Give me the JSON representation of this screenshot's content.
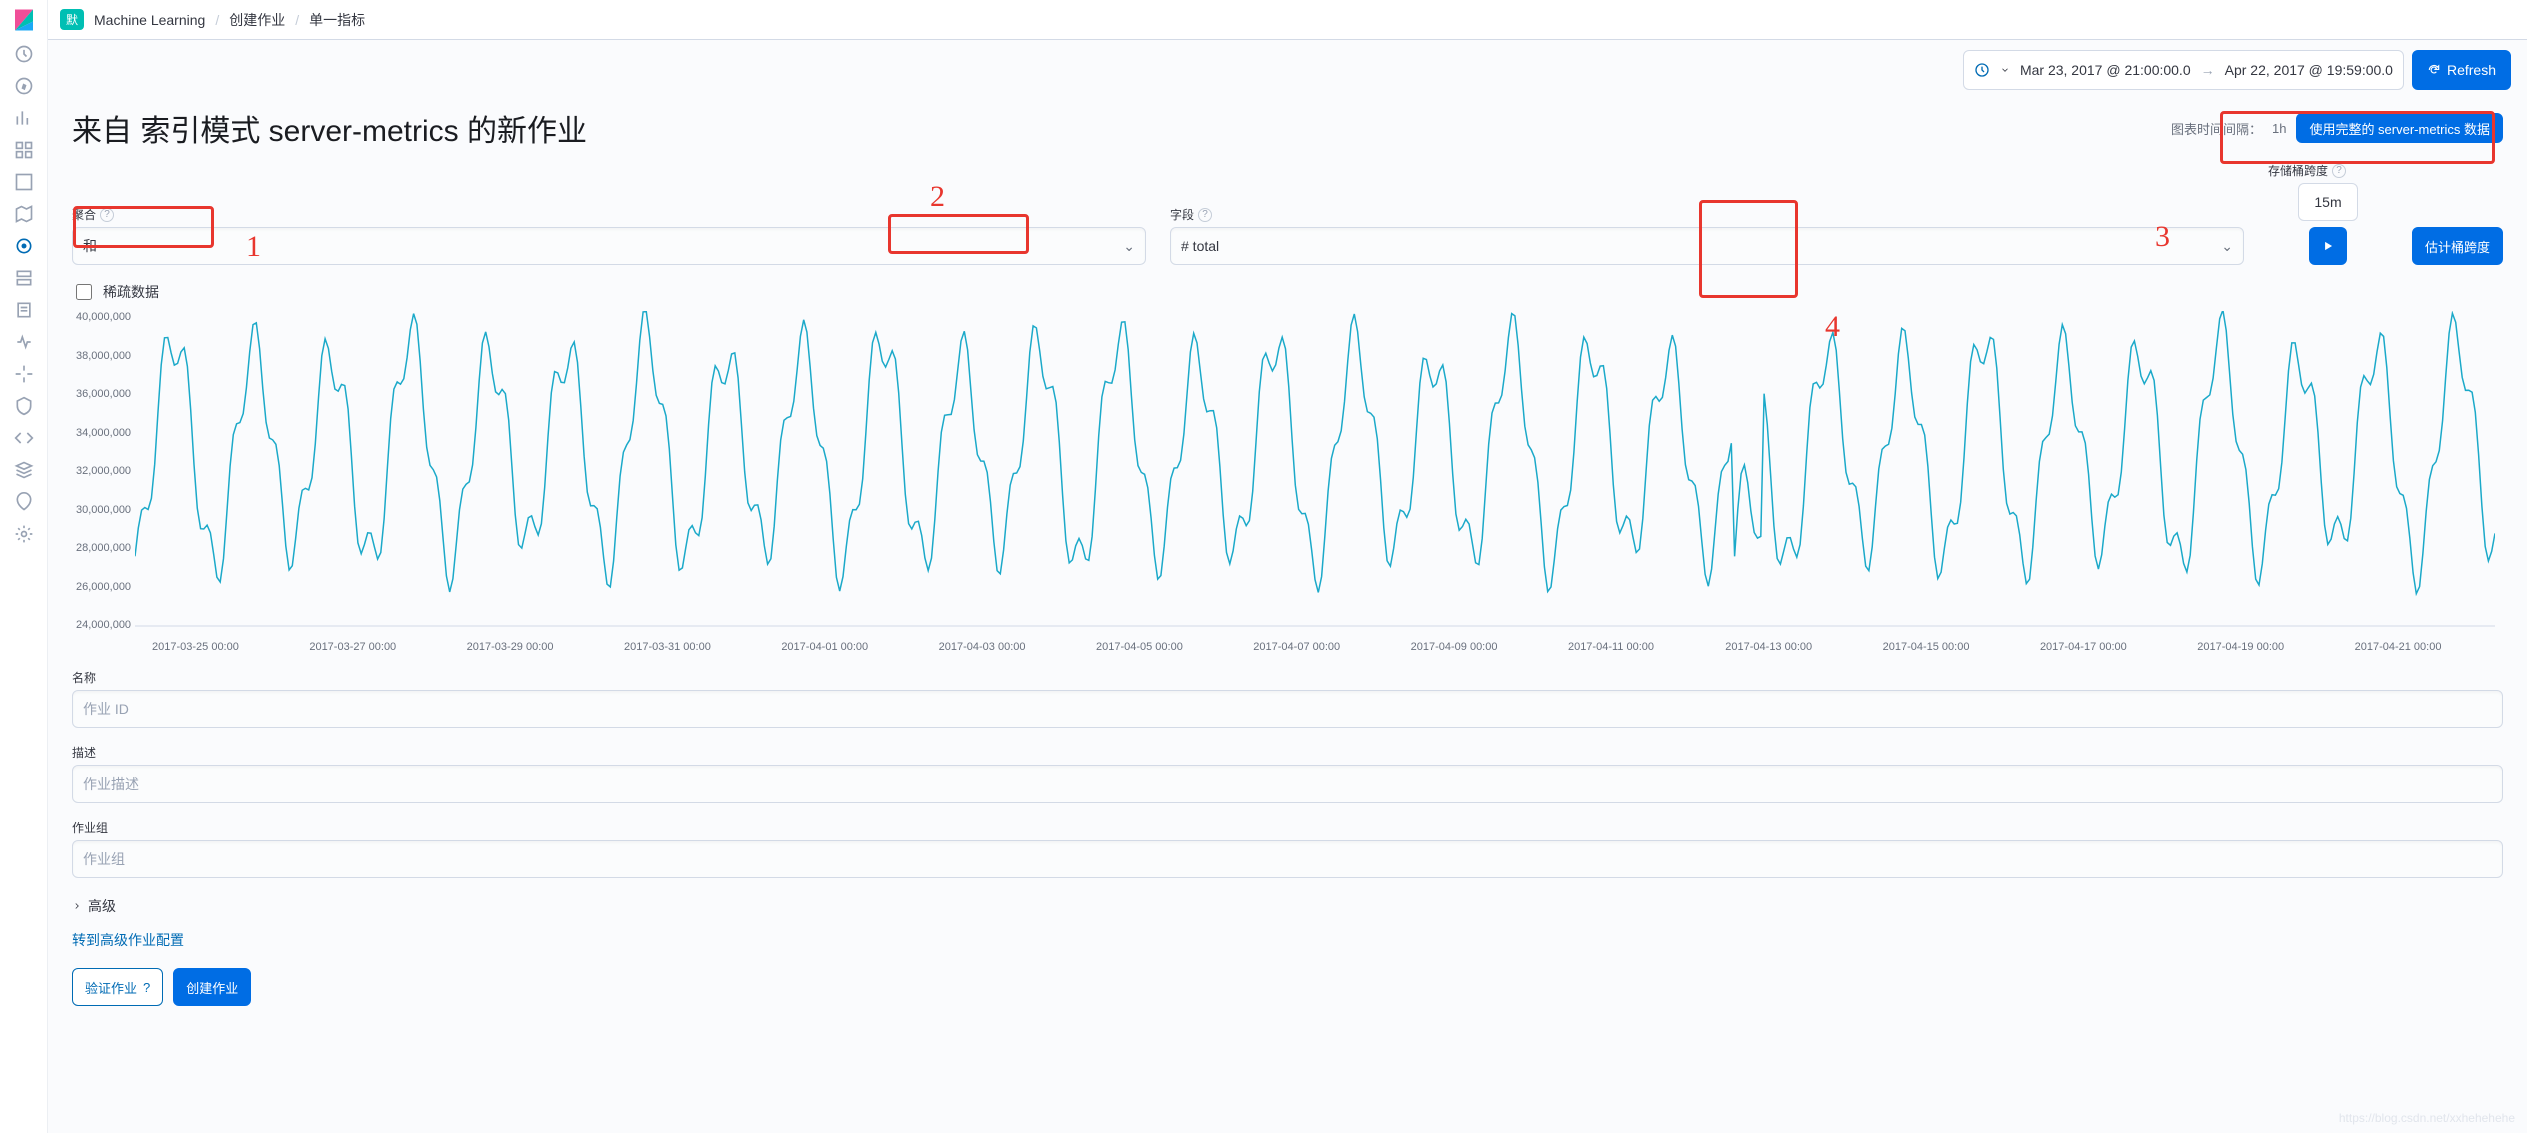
{
  "breadcrumb": {
    "badge": "默",
    "root": "Machine Learning",
    "mid": "创建作业",
    "leaf": "单一指标"
  },
  "time": {
    "from": "Mar 23, 2017 @ 21:00:00.0",
    "to": "Apr 22, 2017 @ 19:59:00.0",
    "refresh": "Refresh"
  },
  "title": "来自 索引模式 server-metrics 的新作业",
  "title_right": {
    "label": "图表时间间隔：",
    "value": "1h",
    "use_full_btn": "使用完整的 server-metrics 数据"
  },
  "agg": {
    "label": "聚合",
    "value": "和"
  },
  "field": {
    "label": "字段",
    "value": "# total"
  },
  "bucket": {
    "label": "存储桶跨度",
    "value": "15m",
    "estimate_btn": "估计桶跨度"
  },
  "sparse": {
    "label": "稀疏数据"
  },
  "name_field": {
    "label": "名称",
    "placeholder": "作业 ID"
  },
  "desc_field": {
    "label": "描述",
    "placeholder": "作业描述"
  },
  "group_field": {
    "label": "作业组",
    "placeholder": "作业组"
  },
  "advanced": "高级",
  "goto_adv": "转到高级作业配置",
  "validate_btn": "验证作业",
  "create_btn": "创建作业",
  "annotations": {
    "a1": "1",
    "a2": "2",
    "a3": "3",
    "a4": "4"
  },
  "watermark": "https://blog.csdn.net/xxhehehehe",
  "chart_data": {
    "type": "line",
    "title": "",
    "xlabel": "",
    "ylabel": "",
    "ylim": [
      24000000,
      40000000
    ],
    "y_ticks": [
      40000000,
      38000000,
      36000000,
      34000000,
      32000000,
      30000000,
      28000000,
      26000000,
      24000000
    ],
    "x_ticks": [
      "2017-03-25 00:00",
      "2017-03-27 00:00",
      "2017-03-29 00:00",
      "2017-03-31 00:00",
      "2017-04-01 00:00",
      "2017-04-03 00:00",
      "2017-04-05 00:00",
      "2017-04-07 00:00",
      "2017-04-09 00:00",
      "2017-04-11 00:00",
      "2017-04-13 00:00",
      "2017-04-15 00:00",
      "2017-04-17 00:00",
      "2017-04-19 00:00",
      "2017-04-21 00:00"
    ],
    "x_range_days": 30,
    "series": [
      {
        "name": "sum(total)",
        "pattern": "daily-cycle",
        "approx_min": 27000000,
        "approx_max": 39000000,
        "notable_dip_day": "2017-04-13",
        "notable_dip_value": 25000000
      }
    ]
  }
}
